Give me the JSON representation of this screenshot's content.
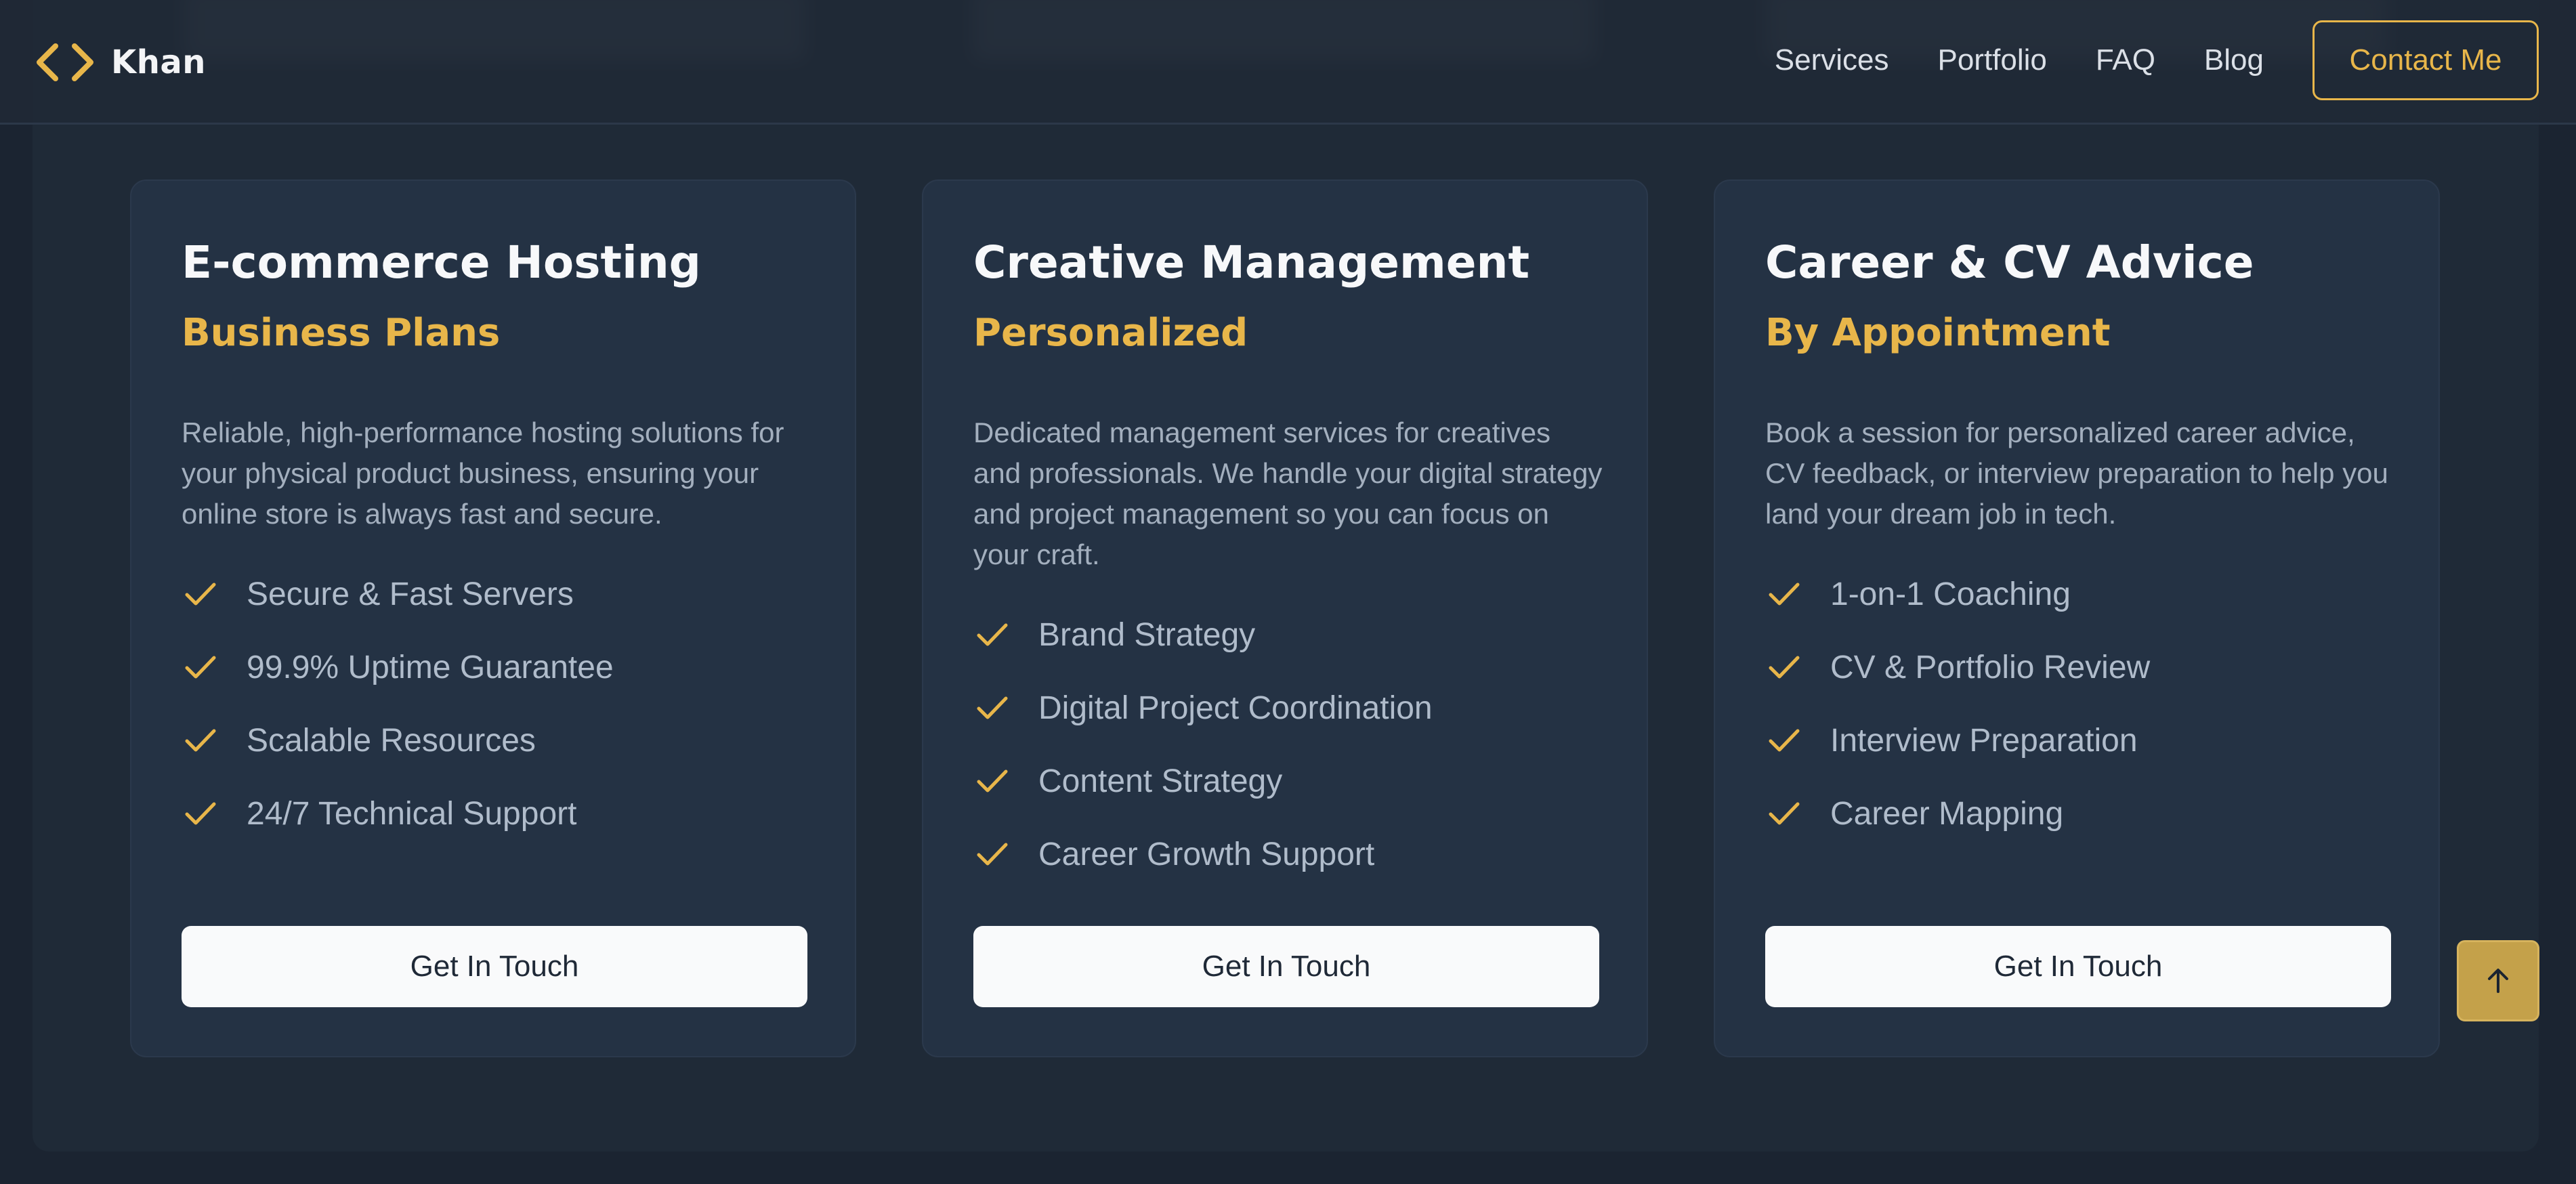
{
  "brand": {
    "name": "Khan",
    "icon": "code-brackets-icon",
    "accent": "#e8b64a"
  },
  "nav": {
    "items": [
      {
        "label": "Services"
      },
      {
        "label": "Portfolio"
      },
      {
        "label": "FAQ"
      },
      {
        "label": "Blog"
      }
    ],
    "contact_label": "Contact Me"
  },
  "cards": [
    {
      "title": "E-commerce Hosting",
      "subtitle": "Business Plans",
      "description": "Reliable, high-performance hosting solutions for your physical product business, ensuring your online store is always fast and secure.",
      "features": [
        "Secure & Fast Servers",
        "99.9% Uptime Guarantee",
        "Scalable Resources",
        "24/7 Technical Support"
      ],
      "cta": "Get In Touch"
    },
    {
      "title": "Creative Management",
      "subtitle": "Personalized",
      "description": "Dedicated management services for creatives and professionals. We handle your digital strategy and project management so you can focus on your craft.",
      "features": [
        "Brand Strategy",
        "Digital Project Coordination",
        "Content Strategy",
        "Career Growth Support"
      ],
      "cta": "Get In Touch"
    },
    {
      "title": "Career & CV Advice",
      "subtitle": "By Appointment",
      "description": "Book a session for personalized career advice, CV feedback, or interview preparation to help you land your dream job in tech.",
      "features": [
        "1-on-1 Coaching",
        "CV & Portfolio Review",
        "Interview Preparation",
        "Career Mapping"
      ],
      "cta": "Get In Touch"
    }
  ],
  "scroll_top": {
    "icon": "arrow-up-icon"
  }
}
